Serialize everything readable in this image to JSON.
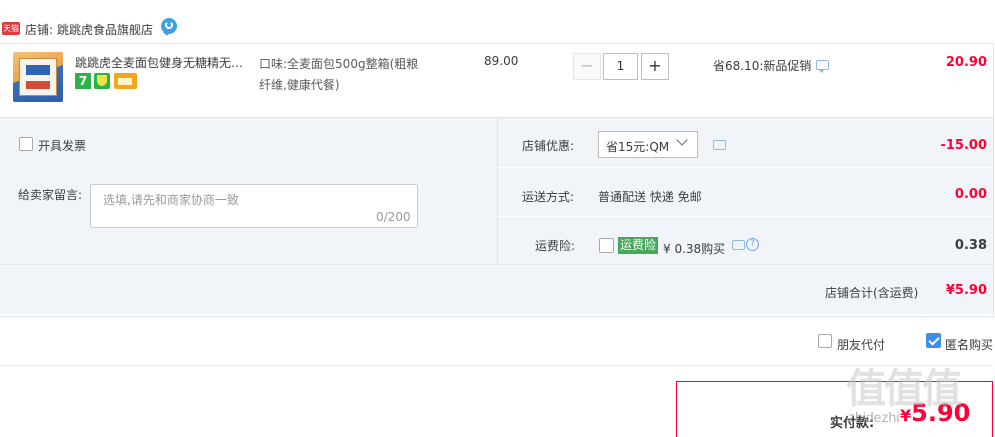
{
  "shop": {
    "badge": "天猫",
    "label": "店铺:",
    "name": "跳跳虎食品旗舰店"
  },
  "item": {
    "title": "跳跳虎全麦面包健身无糖精无油...",
    "sku_line1": "口味:全麦面包500g整箱(粗粮",
    "sku_line2": "纤维,健康代餐)",
    "badge_seven": "7",
    "price": "89.00",
    "qty_minus": "−",
    "quantity": "1",
    "qty_plus": "+",
    "promo": "省68.10:新品促销",
    "total": "20.90"
  },
  "invoice": {
    "label": "开具发票"
  },
  "message": {
    "label": "给卖家留言:",
    "placeholder": "选填,请先和商家协商一致",
    "count": "0/200"
  },
  "discount": {
    "label": "店铺优惠:",
    "selected": "省15元:QM",
    "amount": "-15.00"
  },
  "shipping": {
    "label": "运送方式:",
    "method": "普通配送 快递 免邮",
    "amount": "0.00"
  },
  "insurance": {
    "label": "运费险:",
    "tag": "运费险",
    "price": "¥ 0.38购买",
    "help": "?",
    "amount": "0.38"
  },
  "subtotal": {
    "label": "店铺合计(含运费)",
    "amount": "¥5.90"
  },
  "options": {
    "friend_pay": "朋友代付",
    "anonymous": "匿名购买",
    "anonymous_checked": true
  },
  "payment": {
    "label": "实付款:",
    "currency": "¥",
    "amount": "5.90"
  },
  "watermark": {
    "big": "值值值",
    "site": "zhidezhi"
  },
  "colors": {
    "price_red": "#ff0036",
    "panel_bg": "#f1f5fa",
    "checkbox_blue": "#3d8ee8",
    "insurance_green": "#46a858"
  }
}
